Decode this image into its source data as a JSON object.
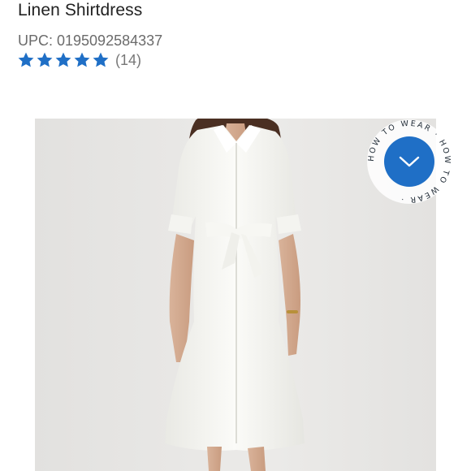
{
  "product": {
    "title": "Linen Shirtdress",
    "upc": "UPC: 0195092584337",
    "rating": {
      "stars": 5,
      "count_text": "(14)"
    }
  },
  "image": {
    "alt": "Woman wearing white linen shirtdress with tie waist"
  },
  "how_to_wear": {
    "ring_text": "HOW TO WEAR · HOW TO WEAR ·"
  },
  "colors": {
    "accent": "#1f6fc6",
    "star": "#1f6fc6",
    "title": "#222222",
    "muted": "#6b6b6b"
  }
}
